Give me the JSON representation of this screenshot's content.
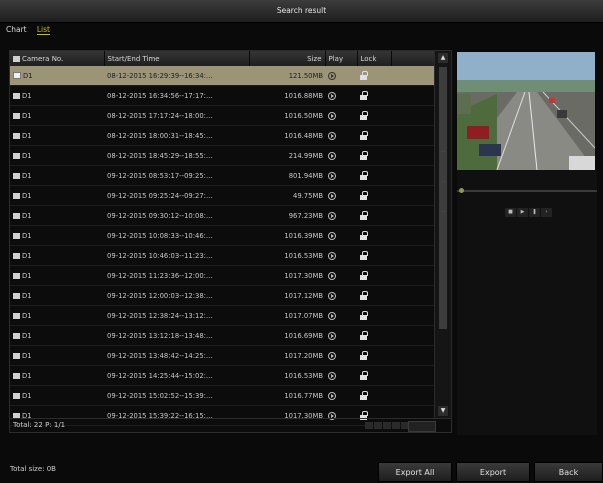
{
  "window": {
    "title": "Search result"
  },
  "tabs": [
    {
      "label": "Chart",
      "active": false
    },
    {
      "label": "List",
      "active": true
    }
  ],
  "list": {
    "headers": {
      "camera": "Camera No.",
      "time": "Start/End Time",
      "size": "Size",
      "play": "Play",
      "lock": "Lock"
    },
    "rows": [
      {
        "camera": "D1",
        "time": "08-12-2015 16:29:39--16:34:...",
        "size": "121.50MB",
        "selected": true
      },
      {
        "camera": "D1",
        "time": "08-12-2015 16:34:56--17:17:...",
        "size": "1016.88MB",
        "selected": false
      },
      {
        "camera": "D1",
        "time": "08-12-2015 17:17:24--18:00:...",
        "size": "1016.50MB",
        "selected": false
      },
      {
        "camera": "D1",
        "time": "08-12-2015 18:00:31--18:45:...",
        "size": "1016.48MB",
        "selected": false
      },
      {
        "camera": "D1",
        "time": "08-12-2015 18:45:29--18:55:...",
        "size": "214.99MB",
        "selected": false
      },
      {
        "camera": "D1",
        "time": "09-12-2015 08:53:17--09:25:...",
        "size": "801.94MB",
        "selected": false
      },
      {
        "camera": "D1",
        "time": "09-12-2015 09:25:24--09:27:...",
        "size": "49.75MB",
        "selected": false
      },
      {
        "camera": "D1",
        "time": "09-12-2015 09:30:12--10:08:...",
        "size": "967.23MB",
        "selected": false
      },
      {
        "camera": "D1",
        "time": "09-12-2015 10:08:33--10:46:...",
        "size": "1016.39MB",
        "selected": false
      },
      {
        "camera": "D1",
        "time": "09-12-2015 10:46:03--11:23:...",
        "size": "1016.53MB",
        "selected": false
      },
      {
        "camera": "D1",
        "time": "09-12-2015 11:23:36--12:00:...",
        "size": "1017.30MB",
        "selected": false
      },
      {
        "camera": "D1",
        "time": "09-12-2015 12:00:03--12:38:...",
        "size": "1017.12MB",
        "selected": false
      },
      {
        "camera": "D1",
        "time": "09-12-2015 12:38:24--13:12:...",
        "size": "1017.07MB",
        "selected": false
      },
      {
        "camera": "D1",
        "time": "09-12-2015 13:12:18--13:48:...",
        "size": "1016.69MB",
        "selected": false
      },
      {
        "camera": "D1",
        "time": "09-12-2015 13:48:42--14:25:...",
        "size": "1017.20MB",
        "selected": false
      },
      {
        "camera": "D1",
        "time": "09-12-2015 14:25:44--15:02:...",
        "size": "1016.53MB",
        "selected": false
      },
      {
        "camera": "D1",
        "time": "09-12-2015 15:02:52--15:39:...",
        "size": "1016.77MB",
        "selected": false
      },
      {
        "camera": "D1",
        "time": "09-12-2015 15:39:22--16:15:...",
        "size": "1017.30MB",
        "selected": false
      }
    ],
    "total": "Total: 22  P: 1/1"
  },
  "footer": {
    "total_size": "Total size: 0B",
    "export_all": "Export All",
    "export": "Export",
    "back": "Back"
  },
  "icons": {
    "play": "play-icon",
    "lock": "unlock-icon",
    "scroll_up": "arrow-up-icon",
    "scroll_down": "arrow-down-icon"
  },
  "colors": {
    "selected_row": "#9b9477",
    "active_tab": "#c8c400"
  }
}
